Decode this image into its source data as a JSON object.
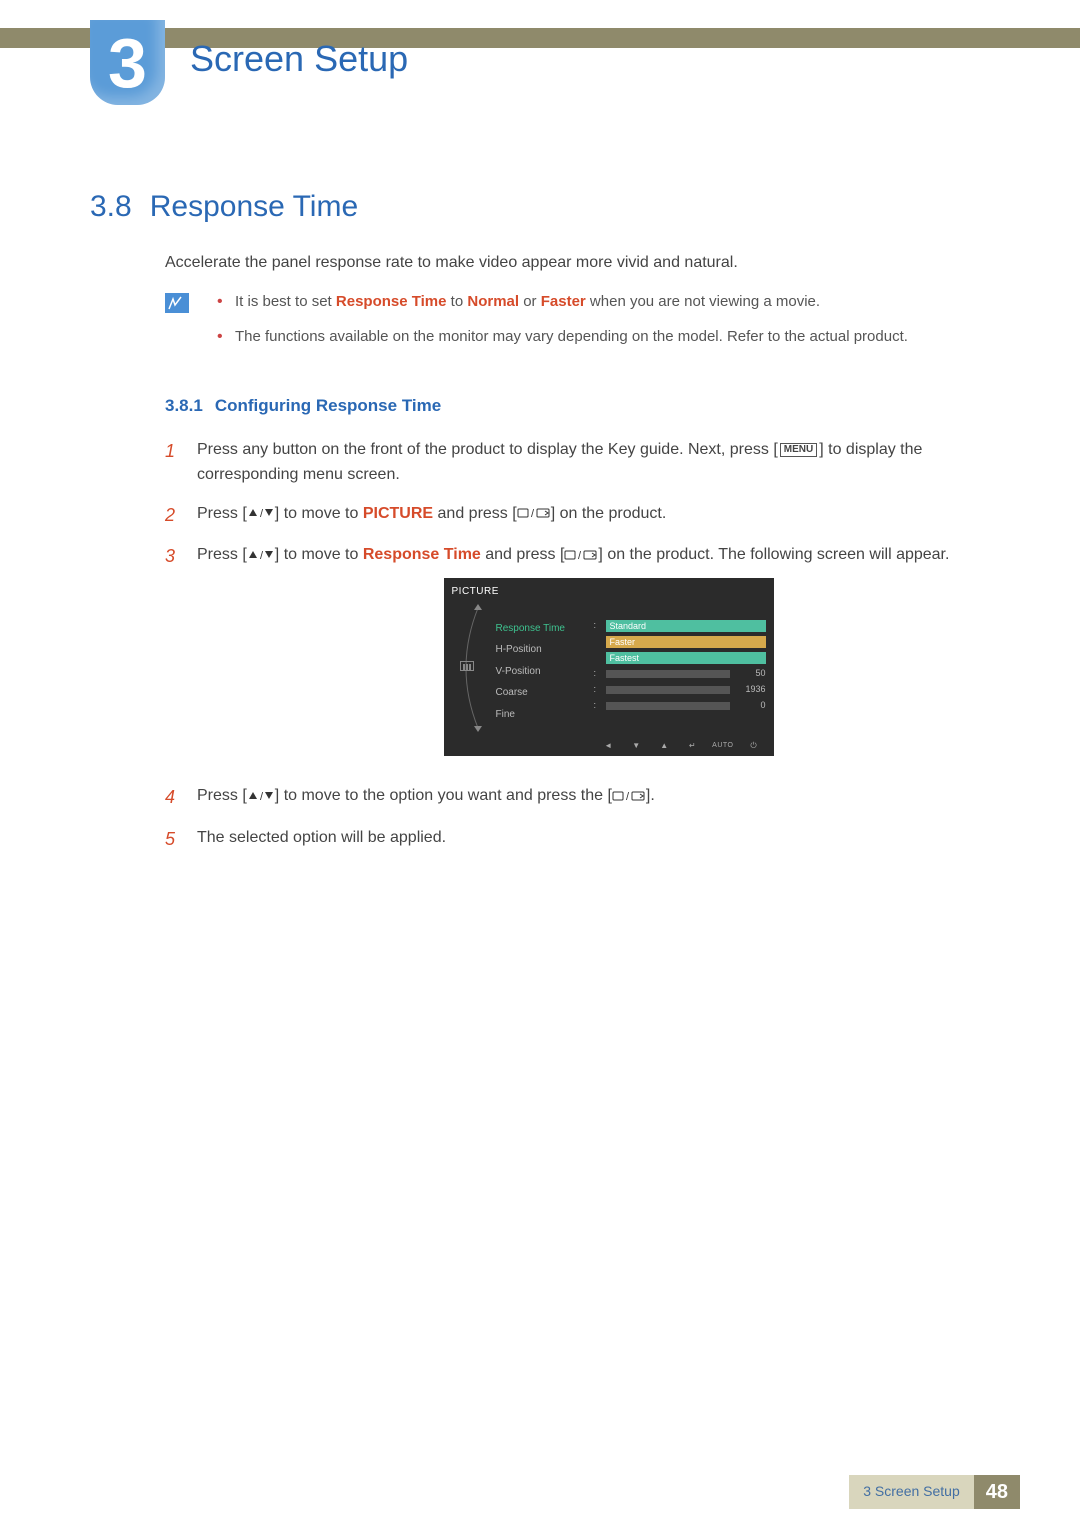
{
  "chapter": {
    "number": "3",
    "title": "Screen Setup"
  },
  "section": {
    "number": "3.8",
    "title": "Response Time"
  },
  "intro": "Accelerate the panel response rate to make video appear more vivid and natural.",
  "notes": {
    "item1_a": "It is best to set ",
    "item1_rt": "Response Time",
    "item1_b": " to ",
    "item1_norm": "Normal",
    "item1_c": " or ",
    "item1_fast": "Faster",
    "item1_d": " when you are not viewing a movie.",
    "item2": "The functions available on the monitor may vary depending on the model. Refer to the actual product."
  },
  "subsection": {
    "number": "3.8.1",
    "title": "Configuring Response Time"
  },
  "steps": {
    "s1_a": "Press any button on the front of the product to display the Key guide. Next, press [",
    "s1_menu": "MENU",
    "s1_b": "] to display the corresponding menu screen.",
    "s2_a": "Press [",
    "s2_b": "] to move to ",
    "s2_pic": "PICTURE",
    "s2_c": " and press [",
    "s2_d": "] on the product.",
    "s3_a": "Press [",
    "s3_b": "] to move to ",
    "s3_rt": "Response Time",
    "s3_c": " and press [",
    "s3_d": "] on the product. The following screen will appear.",
    "s4_a": "Press [",
    "s4_b": "] to move to the option you want and press the [",
    "s4_c": "].",
    "s5": "The selected option will be applied."
  },
  "osd": {
    "title": "PICTURE",
    "menu": {
      "responseTime": "Response Time",
      "hpos": "H-Position",
      "vpos": "V-Position",
      "coarse": "Coarse",
      "fine": "Fine"
    },
    "options": {
      "standard": "Standard",
      "faster": "Faster",
      "fastest": "Fastest"
    },
    "values": {
      "hpos": "50",
      "coarse": "1936",
      "fine": "0"
    },
    "auto": "AUTO"
  },
  "footer": {
    "label": "3 Screen Setup",
    "page": "48"
  }
}
